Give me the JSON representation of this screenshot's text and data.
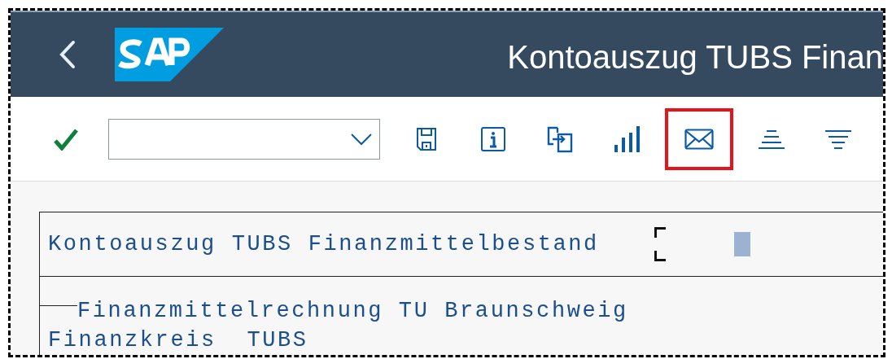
{
  "header": {
    "title": "Kontoauszug TUBS Finan"
  },
  "toolbar": {
    "buttons": [
      {
        "kind": "save",
        "highlighted": false
      },
      {
        "kind": "info",
        "highlighted": false
      },
      {
        "kind": "export",
        "highlighted": false
      },
      {
        "kind": "chart",
        "highlighted": false
      },
      {
        "kind": "mail",
        "highlighted": true
      },
      {
        "kind": "align",
        "highlighted": false
      },
      {
        "kind": "filter",
        "highlighted": false
      }
    ]
  },
  "report": {
    "title": "Kontoauszug TUBS Finanzmittelbestand",
    "lines": [
      "Finanzmittelrechnung TU Braunschweig",
      "Finanzkreis  TUBS"
    ]
  }
}
